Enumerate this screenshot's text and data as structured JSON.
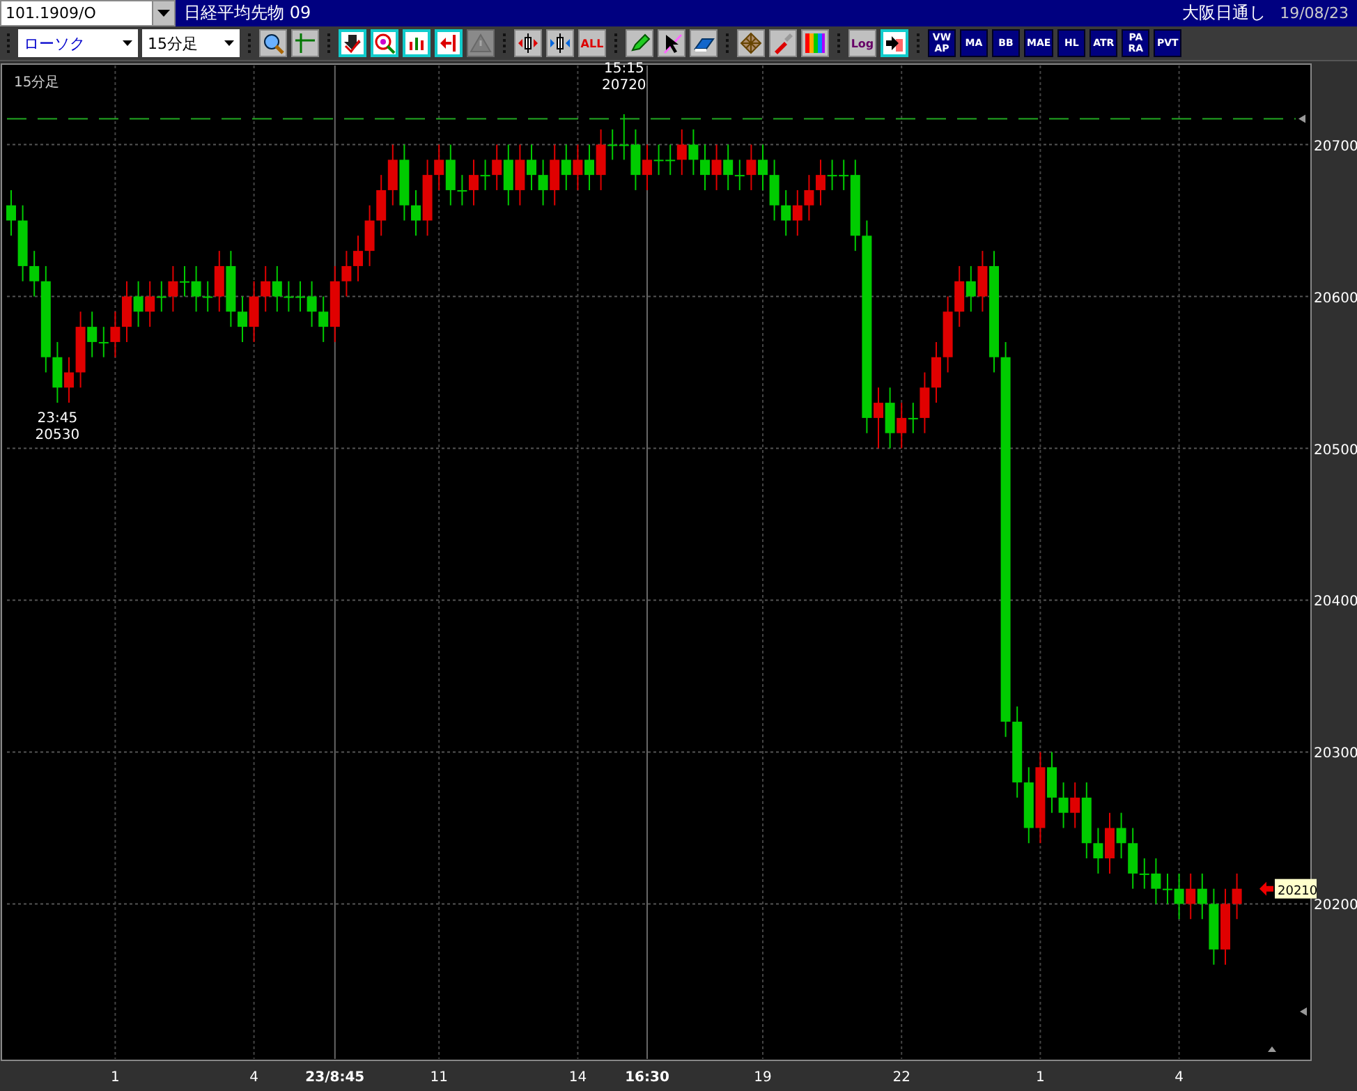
{
  "symbol_field": {
    "value": "101.1909/O"
  },
  "title_bar": {
    "instrument": "日経平均先物 09",
    "session": "大阪日通し",
    "date": "19/08/23"
  },
  "toolbar": {
    "chart_type": {
      "value": "ローソク"
    },
    "interval": {
      "value": "15分足"
    },
    "items": [
      {
        "kind": "separator",
        "disabled": false
      },
      {
        "kind": "icon",
        "disabled": false
      },
      {
        "kind": "icon",
        "disabled": false
      },
      {
        "kind": "separator",
        "disabled": false
      },
      {
        "kind": "icon",
        "disabled": false
      },
      {
        "kind": "icon",
        "disabled": false
      },
      {
        "kind": "icon",
        "disabled": false
      },
      {
        "kind": "icon",
        "disabled": false
      },
      {
        "kind": "icon",
        "disabled": true
      },
      {
        "kind": "separator",
        "disabled": false
      },
      {
        "kind": "icon",
        "disabled": false
      },
      {
        "kind": "icon",
        "disabled": false
      },
      {
        "kind": "label",
        "label": "ALL",
        "disabled": false
      },
      {
        "kind": "separator",
        "disabled": false
      },
      {
        "kind": "icon",
        "disabled": false
      },
      {
        "kind": "icon",
        "disabled": false
      },
      {
        "kind": "icon",
        "disabled": false
      },
      {
        "kind": "separator",
        "disabled": false
      },
      {
        "kind": "icon",
        "disabled": false
      },
      {
        "kind": "icon",
        "disabled": false
      },
      {
        "kind": "icon",
        "disabled": false
      },
      {
        "kind": "separator",
        "disabled": false
      },
      {
        "kind": "label",
        "label": "Log",
        "disabled": false
      },
      {
        "kind": "icon",
        "disabled": false
      },
      {
        "kind": "separator",
        "disabled": false
      },
      {
        "kind": "indicator",
        "lines": [
          "VW",
          "AP"
        ],
        "disabled": false
      },
      {
        "kind": "indicator",
        "lines": [
          "MA"
        ],
        "disabled": false
      },
      {
        "kind": "indicator",
        "lines": [
          "BB"
        ],
        "disabled": false
      },
      {
        "kind": "indicator",
        "lines": [
          "MAE"
        ],
        "disabled": false
      },
      {
        "kind": "indicator",
        "lines": [
          "HL"
        ],
        "disabled": false
      },
      {
        "kind": "indicator",
        "lines": [
          "ATR"
        ],
        "disabled": false
      },
      {
        "kind": "indicator",
        "lines": [
          "PA",
          "RA"
        ],
        "disabled": false
      },
      {
        "kind": "indicator",
        "lines": [
          "PVT"
        ],
        "disabled": false
      }
    ]
  },
  "chart": {
    "high_label": {
      "time": "15:15",
      "price": "20720"
    },
    "low_label": {
      "time": "23:45",
      "price": "20530"
    },
    "last_price": {
      "label": "20210"
    },
    "chart_data": {
      "type": "candlestick",
      "title": "15分足",
      "grid": true,
      "categories": [
        null,
        null,
        null,
        null,
        null,
        null,
        null,
        null,
        null,
        "1",
        null,
        null,
        null,
        null,
        null,
        null,
        null,
        null,
        null,
        null,
        null,
        "4",
        null,
        null,
        null,
        null,
        null,
        null,
        "23/8:45",
        null,
        null,
        null,
        null,
        null,
        null,
        null,
        null,
        "11",
        null,
        null,
        null,
        null,
        null,
        null,
        null,
        null,
        null,
        null,
        null,
        "14",
        null,
        null,
        null,
        null,
        null,
        "16:30",
        null,
        null,
        null,
        null,
        null,
        null,
        null,
        null,
        null,
        "19",
        null,
        null,
        null,
        null,
        null,
        null,
        null,
        null,
        null,
        null,
        null,
        "22",
        null,
        null,
        null,
        null,
        null,
        null,
        null,
        null,
        null,
        null,
        null,
        "1",
        null,
        null,
        null,
        null,
        null,
        null,
        null,
        null,
        null,
        null,
        null,
        "4",
        null,
        null,
        null,
        null,
        null
      ],
      "ohlc": [
        [
          20660,
          20670,
          20640,
          20650
        ],
        [
          20650,
          20660,
          20610,
          20620
        ],
        [
          20620,
          20630,
          20600,
          20610
        ],
        [
          20610,
          20620,
          20550,
          20560
        ],
        [
          20560,
          20570,
          20530,
          20540
        ],
        [
          20540,
          20560,
          20530,
          20550
        ],
        [
          20550,
          20590,
          20540,
          20580
        ],
        [
          20580,
          20590,
          20560,
          20570
        ],
        [
          20570,
          20580,
          20560,
          20570
        ],
        [
          20570,
          20590,
          20560,
          20580
        ],
        [
          20580,
          20610,
          20570,
          20600
        ],
        [
          20600,
          20610,
          20580,
          20590
        ],
        [
          20590,
          20610,
          20580,
          20600
        ],
        [
          20600,
          20610,
          20590,
          20600
        ],
        [
          20600,
          20620,
          20590,
          20610
        ],
        [
          20610,
          20620,
          20600,
          20610
        ],
        [
          20610,
          20620,
          20590,
          20600
        ],
        [
          20600,
          20610,
          20590,
          20600
        ],
        [
          20600,
          20630,
          20590,
          20620
        ],
        [
          20620,
          20630,
          20580,
          20590
        ],
        [
          20590,
          20600,
          20570,
          20580
        ],
        [
          20580,
          20610,
          20570,
          20600
        ],
        [
          20600,
          20620,
          20590,
          20610
        ],
        [
          20610,
          20620,
          20590,
          20600
        ],
        [
          20600,
          20610,
          20590,
          20600
        ],
        [
          20600,
          20610,
          20590,
          20600
        ],
        [
          20600,
          20610,
          20580,
          20590
        ],
        [
          20590,
          20600,
          20570,
          20580
        ],
        [
          20580,
          20620,
          20570,
          20610
        ],
        [
          20610,
          20630,
          20600,
          20620
        ],
        [
          20620,
          20640,
          20610,
          20630
        ],
        [
          20630,
          20660,
          20620,
          20650
        ],
        [
          20650,
          20680,
          20640,
          20670
        ],
        [
          20670,
          20700,
          20660,
          20690
        ],
        [
          20690,
          20700,
          20650,
          20660
        ],
        [
          20660,
          20670,
          20640,
          20650
        ],
        [
          20650,
          20690,
          20640,
          20680
        ],
        [
          20680,
          20700,
          20670,
          20690
        ],
        [
          20690,
          20700,
          20660,
          20670
        ],
        [
          20670,
          20680,
          20660,
          20670
        ],
        [
          20670,
          20690,
          20660,
          20680
        ],
        [
          20680,
          20690,
          20670,
          20680
        ],
        [
          20680,
          20700,
          20670,
          20690
        ],
        [
          20690,
          20700,
          20660,
          20670
        ],
        [
          20670,
          20700,
          20660,
          20690
        ],
        [
          20690,
          20700,
          20670,
          20680
        ],
        [
          20680,
          20690,
          20660,
          20670
        ],
        [
          20670,
          20700,
          20660,
          20690
        ],
        [
          20690,
          20700,
          20670,
          20680
        ],
        [
          20680,
          20700,
          20670,
          20690
        ],
        [
          20690,
          20700,
          20670,
          20680
        ],
        [
          20680,
          20710,
          20670,
          20700
        ],
        [
          20700,
          20710,
          20690,
          20700
        ],
        [
          20700,
          20720,
          20690,
          20700
        ],
        [
          20700,
          20710,
          20670,
          20680
        ],
        [
          20680,
          20700,
          20670,
          20690
        ],
        [
          20690,
          20700,
          20680,
          20690
        ],
        [
          20690,
          20700,
          20680,
          20690
        ],
        [
          20690,
          20710,
          20680,
          20700
        ],
        [
          20700,
          20710,
          20680,
          20690
        ],
        [
          20690,
          20700,
          20670,
          20680
        ],
        [
          20680,
          20700,
          20670,
          20690
        ],
        [
          20690,
          20700,
          20670,
          20680
        ],
        [
          20680,
          20690,
          20670,
          20680
        ],
        [
          20680,
          20700,
          20670,
          20690
        ],
        [
          20690,
          20700,
          20670,
          20680
        ],
        [
          20680,
          20690,
          20650,
          20660
        ],
        [
          20660,
          20670,
          20640,
          20650
        ],
        [
          20650,
          20670,
          20640,
          20660
        ],
        [
          20660,
          20680,
          20650,
          20670
        ],
        [
          20670,
          20690,
          20660,
          20680
        ],
        [
          20680,
          20690,
          20670,
          20680
        ],
        [
          20680,
          20690,
          20670,
          20680
        ],
        [
          20680,
          20690,
          20630,
          20640
        ],
        [
          20640,
          20650,
          20510,
          20520
        ],
        [
          20520,
          20540,
          20500,
          20530
        ],
        [
          20530,
          20540,
          20500,
          20510
        ],
        [
          20510,
          20530,
          20500,
          20520
        ],
        [
          20520,
          20530,
          20510,
          20520
        ],
        [
          20520,
          20550,
          20510,
          20540
        ],
        [
          20540,
          20570,
          20530,
          20560
        ],
        [
          20560,
          20600,
          20550,
          20590
        ],
        [
          20590,
          20620,
          20580,
          20610
        ],
        [
          20610,
          20620,
          20590,
          20600
        ],
        [
          20600,
          20630,
          20590,
          20620
        ],
        [
          20620,
          20630,
          20550,
          20560
        ],
        [
          20560,
          20570,
          20310,
          20320
        ],
        [
          20320,
          20330,
          20270,
          20280
        ],
        [
          20280,
          20290,
          20240,
          20250
        ],
        [
          20250,
          20300,
          20240,
          20290
        ],
        [
          20290,
          20300,
          20260,
          20270
        ],
        [
          20270,
          20280,
          20250,
          20260
        ],
        [
          20260,
          20280,
          20250,
          20270
        ],
        [
          20270,
          20280,
          20230,
          20240
        ],
        [
          20240,
          20250,
          20220,
          20230
        ],
        [
          20230,
          20260,
          20220,
          20250
        ],
        [
          20250,
          20260,
          20230,
          20240
        ],
        [
          20240,
          20250,
          20210,
          20220
        ],
        [
          20220,
          20230,
          20210,
          20220
        ],
        [
          20220,
          20230,
          20200,
          20210
        ],
        [
          20210,
          20220,
          20200,
          20210
        ],
        [
          20210,
          20220,
          20190,
          20200
        ],
        [
          20200,
          20220,
          20190,
          20210
        ],
        [
          20210,
          20220,
          20190,
          20200
        ],
        [
          20200,
          20210,
          20160,
          20170
        ],
        [
          20170,
          20210,
          20160,
          20200
        ],
        [
          20200,
          20220,
          20190,
          20210
        ]
      ],
      "ylim": [
        20097,
        20753
      ],
      "yticks": [
        {
          "value": 20700,
          "label": "20700"
        },
        {
          "value": 20600,
          "label": "20600"
        },
        {
          "value": 20500,
          "label": "20500"
        },
        {
          "value": 20400,
          "label": "20400"
        },
        {
          "value": 20300,
          "label": "20300"
        },
        {
          "value": 20200,
          "label": "20200"
        }
      ],
      "ref_lines": [
        {
          "axis": "y",
          "value": 20717
        }
      ]
    }
  }
}
